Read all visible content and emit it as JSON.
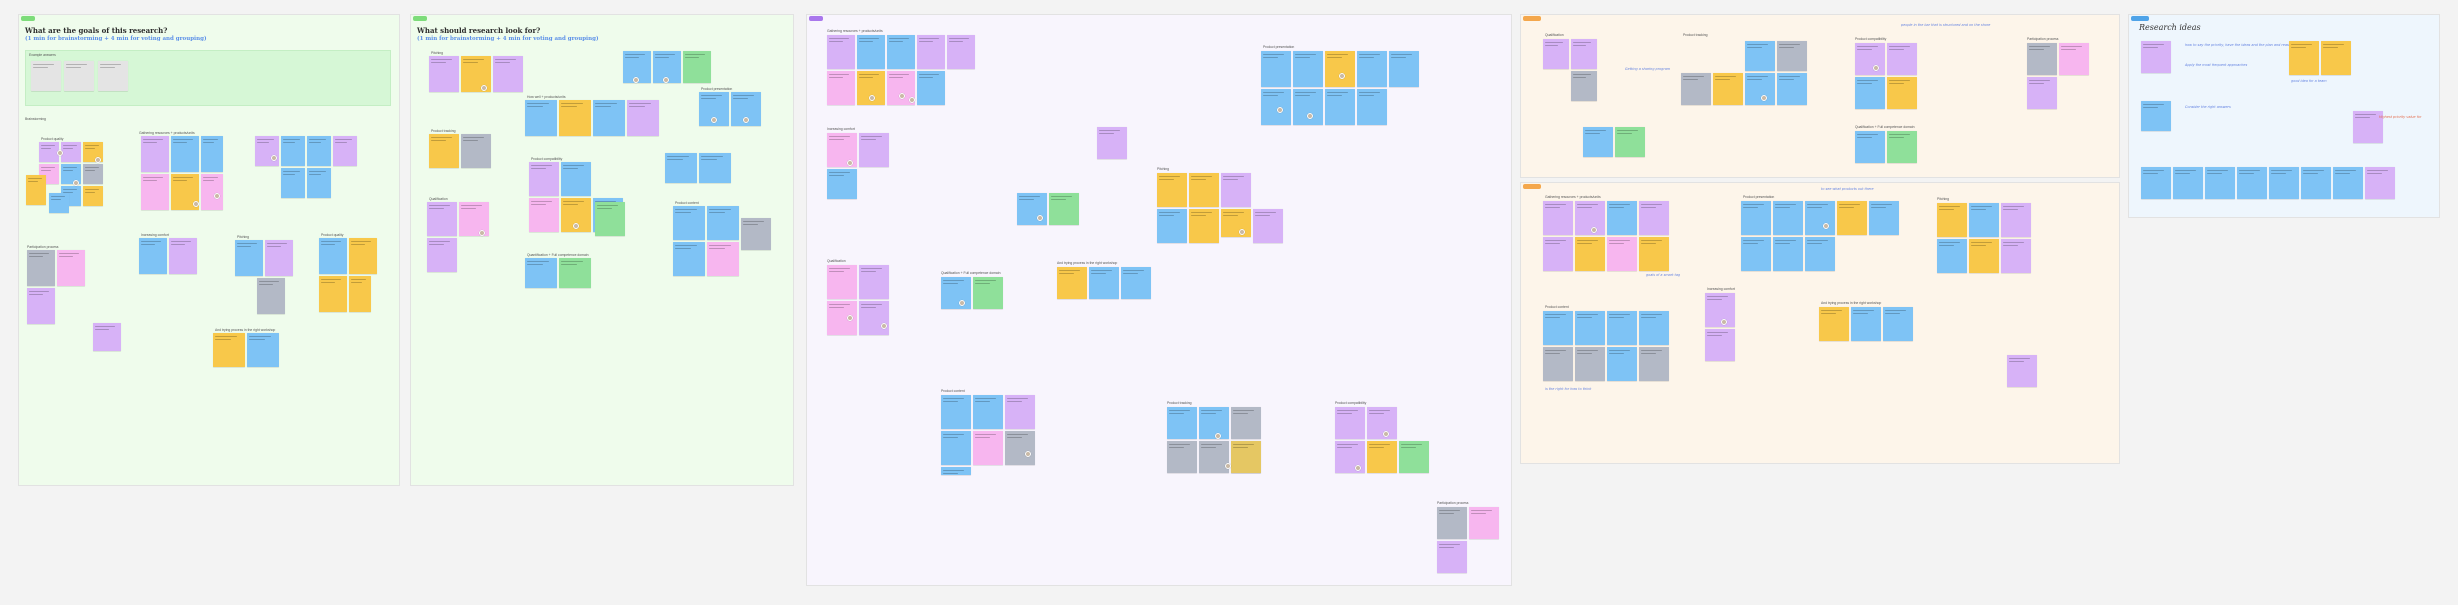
{
  "board": {
    "section1": {
      "title": "What are the goals of this research?",
      "subtitle": "(1 min for brainstorming + 4 min for voting and grouping)",
      "labels": [
        "Example answers",
        "Brainstorming",
        "Gathering resources + products/units",
        "Increasing comfort",
        "Product quality",
        "Pitching",
        "Participation process",
        "And trying process in the right workshop"
      ]
    },
    "section2": {
      "title": "What should research look for?",
      "subtitle": "(1 min for brainstorming + 4 min for voting and grouping)",
      "labels": [
        "Pitching",
        "Product tracking",
        "Qualification",
        "How well + products/units",
        "Product compatibility",
        "Product presentation",
        "Product content",
        "Quantification + Full competence domain"
      ]
    },
    "section3": {
      "labels": [
        "Gathering resources + products/units",
        "Increasing comfort",
        "Qualification",
        "Product presentation",
        "Pitching",
        "Qualification + Full competence domain",
        "And trying process in the right workshop",
        "Product content",
        "Product tracking",
        "Product compatibility",
        "Participation process"
      ]
    },
    "section4": {
      "labels_top": [
        "Qualification",
        "Product tracking",
        "Product compatibility",
        "Participation process",
        "Qualification + Full competence domain"
      ],
      "labels_bottom": [
        "Gathering resources + products/units",
        "Product presentation",
        "Pitching",
        "Increasing comfort",
        "Product content",
        "And trying process in the right workshop"
      ],
      "notes_top": [
        "Getting a sharing program",
        "people in the bar that is structured and on the shore"
      ],
      "notes_bottom": [
        "goals of a smart tag",
        "to see what products out there",
        "is the right for how to think"
      ]
    },
    "section5": {
      "title": "Research ideas",
      "notes": [
        "how to say the priority, have the ideas and the plan and reasons",
        "Apply the most frequent approaches",
        "good idea for a team",
        "Consider the right answers",
        "Highest priority value for"
      ]
    }
  }
}
